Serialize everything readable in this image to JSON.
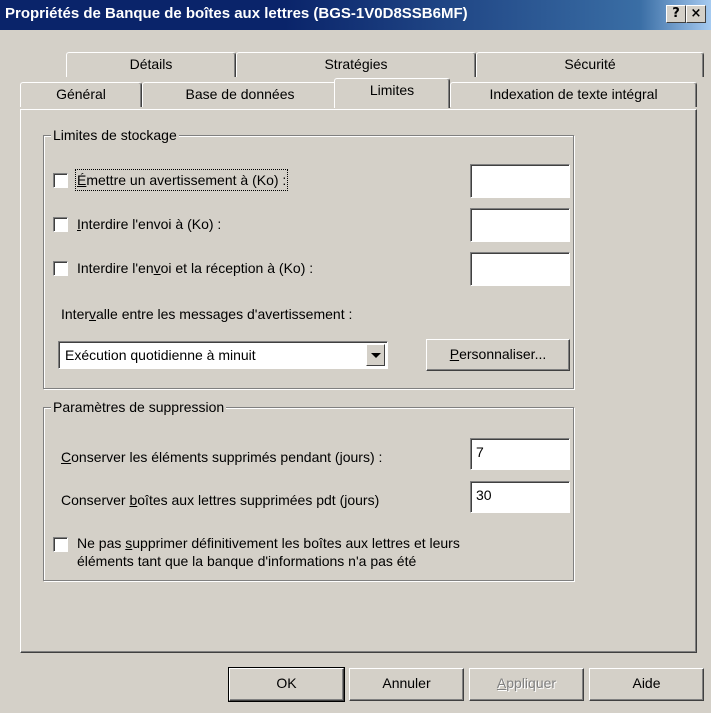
{
  "window": {
    "title": "Propriétés de Banque de boîtes aux lettres (BGS-1V0D8SSB6MF)",
    "help_btn": "?",
    "close_btn": "×"
  },
  "tabs_back": [
    "Détails",
    "Stratégies",
    "Sécurité"
  ],
  "tabs_front": [
    "Général",
    "Base de données",
    "Limites",
    "Indexation de texte intégral"
  ],
  "active_tab": "Limites",
  "storage": {
    "legend": "Limites de stockage",
    "warn": {
      "pre": "",
      "acc": "É",
      "post": "mettre un avertissement à (Ko) :",
      "value": "",
      "checked": false
    },
    "send": {
      "pre": "",
      "acc": "I",
      "post": "nterdire l'envoi à (Ko) :",
      "value": "",
      "checked": false
    },
    "sendrecv": {
      "pre": "Interdire l'en",
      "acc": "v",
      "post": "oi et la réception à (Ko) :",
      "value": "",
      "checked": false
    },
    "interval_label": {
      "pre": "Inter",
      "acc": "v",
      "post": "alle entre les messages d'avertissement :"
    },
    "interval_value": "Exécution quotidienne à minuit",
    "customize": {
      "acc": "P",
      "post": "ersonnaliser..."
    }
  },
  "deletion": {
    "legend": "Paramètres de suppression",
    "keep_items": {
      "pre": "",
      "acc": "C",
      "post": "onserver les éléments supprimés pendant (jours) :",
      "value": "7"
    },
    "keep_mailboxes": {
      "pre": "Conserver ",
      "acc": "b",
      "post": "oîtes aux lettres supprimées pdt (jours)",
      "value": "30"
    },
    "no_delete": {
      "pre": "Ne pas ",
      "acc": "s",
      "post": "upprimer définitivement les boîtes aux lettres et leurs",
      "line2": "éléments tant que la banque d'informations n'a pas été",
      "checked": false
    }
  },
  "buttons": {
    "ok": "OK",
    "cancel": "Annuler",
    "apply": "Appliquer",
    "apply_acc": "A",
    "apply_post": "ppliquer",
    "help": "Aide"
  }
}
